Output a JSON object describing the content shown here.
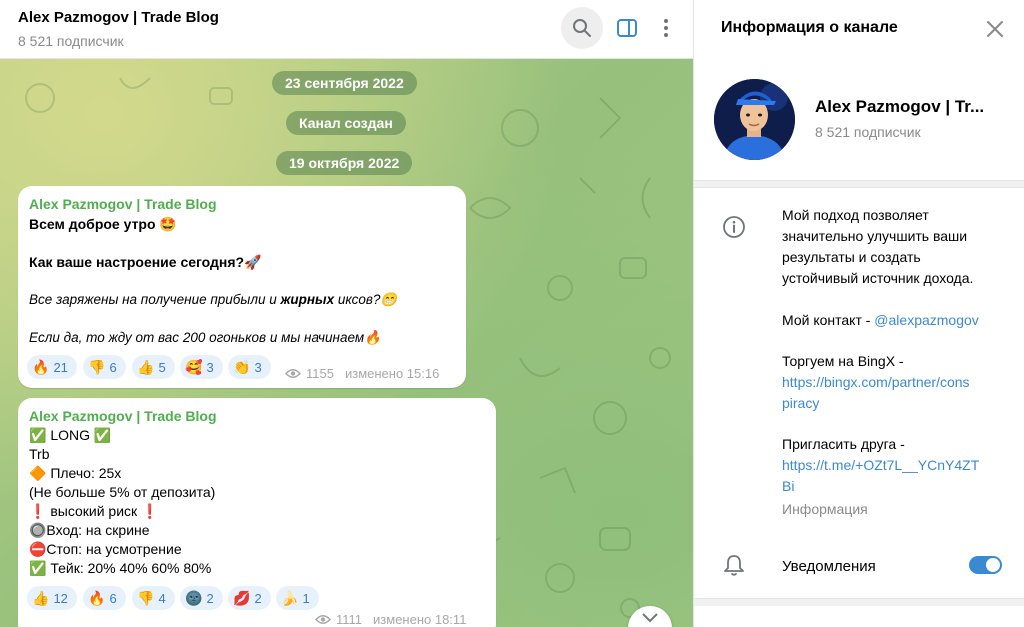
{
  "chat": {
    "title": "Alex Pazmogov | Trade Blog",
    "subscribers": "8 521 подписчик",
    "service_pills": [
      "23 сентября 2022",
      "Канал создан",
      "19 октября 2022"
    ],
    "messages": [
      {
        "author": "Alex Pazmogov | Trade Blog",
        "greeting": "Всем доброе утро 🤩",
        "question": "Как ваше настроение сегодня?🚀",
        "line3_pre": "Все заряжены на получение прибыли и ",
        "line3_bold": "жирных",
        "line3_post": " иксов?😁",
        "line4": "Если да, то жду от вас 200 огоньков и мы начинаем🔥",
        "reactions": [
          {
            "emoji": "🔥",
            "count": "21"
          },
          {
            "emoji": "👎",
            "count": "6"
          },
          {
            "emoji": "👍",
            "count": "5"
          },
          {
            "emoji": "🥰",
            "count": "3"
          },
          {
            "emoji": "👏",
            "count": "3"
          }
        ],
        "views": "1155",
        "edited": "изменено 15:16"
      },
      {
        "author": "Alex Pazmogov | Trade Blog",
        "lines": [
          "✅ LONG ✅",
          "Trb",
          "🔶 Плечо: 25x",
          "(Не больше 5% от депозита)",
          "❗ высокий риск ❗",
          "🔘Вход: на скрине",
          "⛔Стоп: на усмотрение",
          "✅ Тейк: 20% 40% 60% 80%"
        ],
        "reactions": [
          {
            "emoji": "👍",
            "count": "12"
          },
          {
            "emoji": "🔥",
            "count": "6"
          },
          {
            "emoji": "👎",
            "count": "4"
          },
          {
            "emoji": "🌚",
            "count": "2"
          },
          {
            "emoji": "💋",
            "count": "2"
          },
          {
            "emoji": "🍌",
            "count": "1"
          }
        ],
        "views": "1111",
        "edited": "изменено 18:11"
      }
    ]
  },
  "panel": {
    "title": "Информация о канале",
    "name": "Alex Pazmogov | Tr...",
    "subscribers": "8 521 подписчик",
    "description": [
      "Мой подход позволяет",
      "значительно улучшить ваши",
      "результаты и создать",
      "устойчивый источник дохода."
    ],
    "contact_label": "Мой контакт - ",
    "contact_link": "@alexpazmogov",
    "bingx_label": "Торгуем на BingX -",
    "bingx_link_1": "https://bingx.com/partner/cons",
    "bingx_link_2": "piracy",
    "invite_label": "Пригласить друга -",
    "invite_link_1": "https://t.me/+OZt7L__YCnY4ZT",
    "invite_link_2": "Bi",
    "info_caption": "Информация",
    "notifications_label": "Уведомления",
    "notifications_on": true
  },
  "colors": {
    "accent": "#3a8ad3",
    "author": "#4fae4e",
    "reaction_bg": "#e6f1fb"
  },
  "icons": [
    "search-icon",
    "sidebar-toggle-icon",
    "more-vertical-icon",
    "close-icon",
    "info-icon",
    "bell-icon",
    "eye-icon",
    "chevron-down-icon"
  ]
}
